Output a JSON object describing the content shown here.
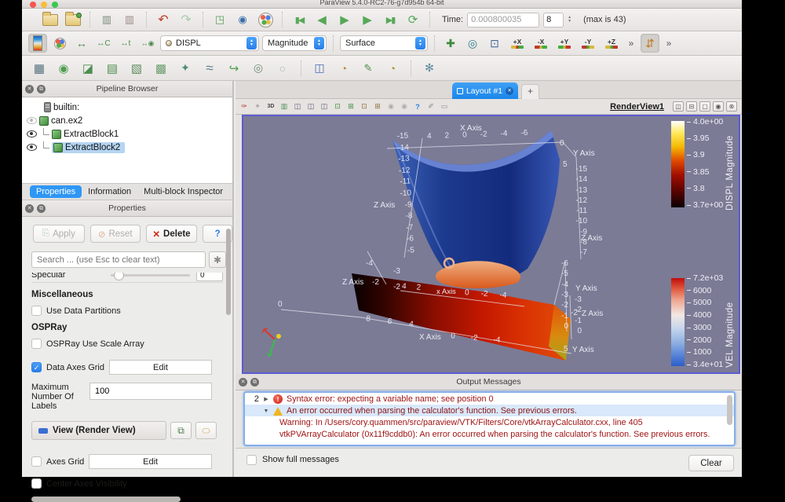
{
  "window": {
    "title": "ParaView 5.4.0-RC2-76-g7d954b 64-bit"
  },
  "icons": {
    "t1": [
      "",
      "",
      "▥",
      "▥",
      "↶",
      "↷",
      "◳",
      "◉",
      "",
      "▮◀",
      "◀",
      "▶",
      "▶",
      "▶▮",
      "⟳"
    ],
    "t2": [
      "",
      "",
      "↔",
      "↔C",
      "↔t",
      "↔◉",
      "✚",
      "◎",
      "⊡",
      "»",
      "⇵",
      "»"
    ],
    "view_dirs": [
      "+X",
      "-X",
      "+Y",
      "-Y",
      "+Z"
    ],
    "t3": [
      "▦",
      "◉",
      "◪",
      "▤",
      "▧",
      "▩",
      "✦",
      "≈",
      "↪",
      "◎",
      "○",
      "◫",
      "◔",
      "✎",
      "◔",
      "✻"
    ],
    "vb": [
      "✑",
      "⌖",
      "3D",
      "▥",
      "◫",
      "◫",
      "◫",
      "⊡",
      "⊞",
      "⊡",
      "⊞",
      "◉",
      "◉",
      "?",
      "✐",
      "▭"
    ],
    "win": [
      "◫",
      "⊟",
      "▢",
      "◉",
      "⊗"
    ],
    "close": "✕",
    "float": "⧉",
    "check": "✓",
    "up": "▲",
    "down": "▼",
    "err": "!",
    "arrow_r": "▶",
    "arrow_d": "▼",
    "gear": "✱",
    "help": "?"
  },
  "toolbar1": {
    "time_label": "Time:",
    "time_value": "0.000800035",
    "frame": "8",
    "max": "(max is 43)"
  },
  "toolbar2": {
    "array": "DISPL",
    "component": "Magnitude",
    "representation": "Surface"
  },
  "pipeline": {
    "title": "Pipeline Browser",
    "builtin": "builtin:",
    "items": [
      "can.ex2",
      "ExtractBlock1",
      "ExtractBlock2"
    ]
  },
  "tabs": [
    "Properties",
    "Information",
    "Multi-block Inspector"
  ],
  "properties": {
    "title": "Properties",
    "apply": "Apply",
    "reset": "Reset",
    "del": "Delete",
    "help": "?",
    "search_placeholder": "Search ... (use Esc to clear text)",
    "specular": "Specular",
    "specular_value": "0",
    "misc": "Miscellaneous",
    "use_data_partitions": "Use Data Partitions",
    "ospray": "OSPRay",
    "ospray_scale": "OSPRay Use Scale Array",
    "data_axes_grid": "Data Axes Grid",
    "edit": "Edit",
    "max_labels": "Maximum Number Of Labels",
    "max_labels_value": "100",
    "view_header": "View (Render View)",
    "axes_grid": "Axes Grid",
    "center_axes": "Center Axes Visibility"
  },
  "layout": {
    "tab": "Layout #1",
    "plus": "+",
    "view": "RenderView1"
  },
  "colorbars": {
    "displ": {
      "title": "DISPL Magnitude",
      "ticks": [
        "4.0e+00",
        "3.95",
        "3.9",
        "3.85",
        "3.8",
        "3.7e+00"
      ]
    },
    "vel": {
      "title": "VEL Magnitude",
      "ticks": [
        "7.2e+03",
        "6000",
        "5000",
        "4000",
        "3000",
        "2000",
        "1000",
        "3.4e+01"
      ]
    }
  },
  "scene": {
    "axis_x": "X Axis",
    "axis_y": "Y Axis",
    "axis_z": "Z Axis",
    "axis_x_lc": "x Axis",
    "tick_0": "0",
    "tick_5": "5",
    "tick_m2": "-2",
    "tick_m4": "-4",
    "can_x": [
      "4",
      "2",
      "0",
      "-2",
      "-4",
      "-6"
    ],
    "can_zl": [
      "-15",
      "-14",
      "-13",
      "-12",
      "-11",
      "-10",
      "-9",
      "-8",
      "-7",
      "-6",
      "-5"
    ],
    "can_zr": [
      "-15",
      "-14",
      "-13",
      "-12",
      "-11",
      "-10",
      "-9",
      "-8",
      "-7"
    ],
    "plate_zl": [
      "-3",
      "-2"
    ],
    "plate_bx1": [
      "8",
      "6",
      "4"
    ],
    "plate_bx2": [
      "0",
      "-2",
      "-4"
    ],
    "plate_mx1": [
      "4",
      "2"
    ],
    "plate_mx2": [
      "0",
      "-2",
      "-4"
    ],
    "plate_r1": [
      "-6",
      "-5",
      "-4",
      "-3",
      "-2",
      "-1",
      "0"
    ],
    "plate_r2": [
      "-3",
      "-2",
      "-1",
      "0"
    ]
  },
  "output": {
    "title": "Output Messages",
    "count": "2",
    "m1": "Syntax error: expecting a variable name;  see position 0",
    "m2": "An error occurred when parsing the calculator's function.  See previous errors.",
    "m3": "Warning: In /Users/cory.quammen/src/paraview/VTK/Filters/Core/vtkArrayCalculator.cxx, line 405",
    "m4": "vtkPVArrayCalculator (0x11f9cddb0): An error occurred when parsing the calculator's function.  See previous errors.",
    "show_full": "Show full messages",
    "clear": "Clear"
  }
}
